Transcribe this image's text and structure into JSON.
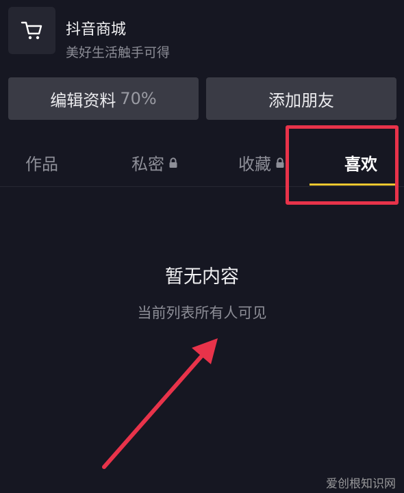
{
  "mall": {
    "title": "抖音商城",
    "subtitle": "美好生活触手可得",
    "icon": "shopping-cart-icon"
  },
  "actions": {
    "edit_label": "编辑资料",
    "edit_progress": "70%",
    "add_friend_label": "添加朋友"
  },
  "tabs": [
    {
      "label": "作品",
      "locked": false
    },
    {
      "label": "私密",
      "locked": true
    },
    {
      "label": "收藏",
      "locked": true
    },
    {
      "label": "喜欢",
      "locked": false,
      "active": true
    }
  ],
  "empty_state": {
    "title": "暂无内容",
    "subtitle": "当前列表所有人可见"
  },
  "annotation": {
    "highlight_color": "#e8334a",
    "arrow_color": "#e8334a"
  },
  "accent_color": "#f2c830",
  "watermark": "爱创根知识网"
}
